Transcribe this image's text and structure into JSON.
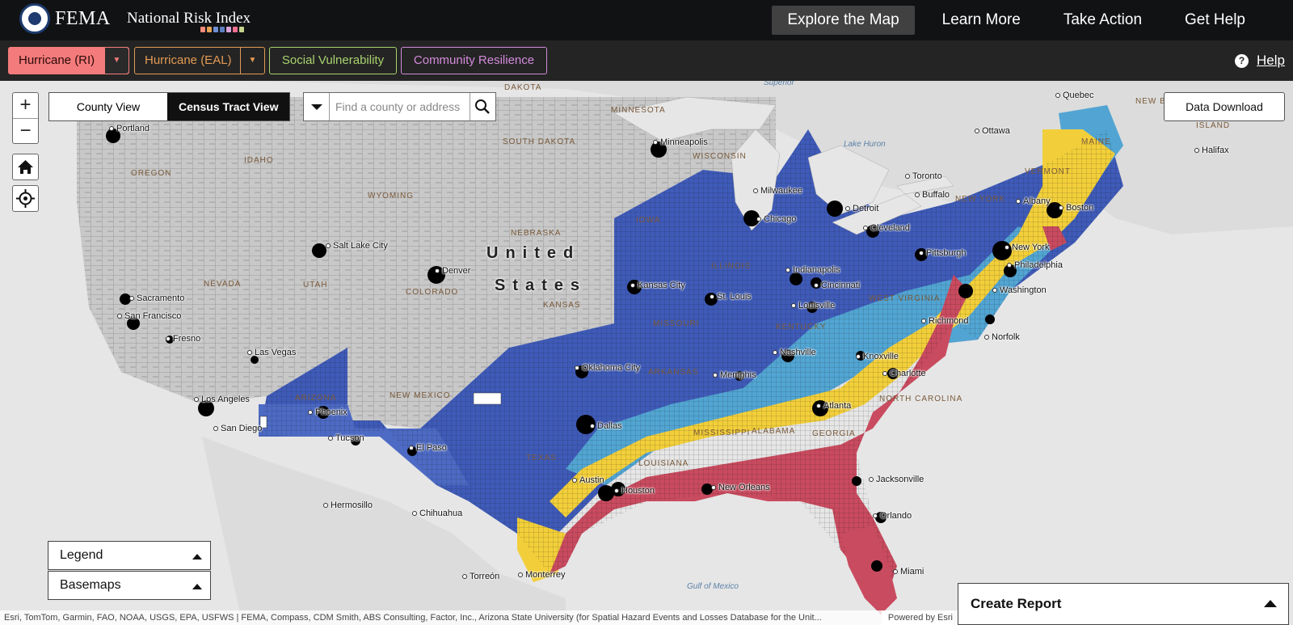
{
  "header": {
    "agency": "FEMA",
    "app_title": "National Risk Index",
    "brand_dots": [
      "#f58b7a",
      "#e2a255",
      "#6f8fd3",
      "#5d7fbf",
      "#d9a3d9",
      "#f06f8f",
      "#c6d38c"
    ],
    "nav": [
      {
        "label": "Explore the Map",
        "active": true
      },
      {
        "label": "Learn More",
        "active": false
      },
      {
        "label": "Take Action",
        "active": false
      },
      {
        "label": "Get Help",
        "active": false
      }
    ]
  },
  "hazard_bar": {
    "risk_index": {
      "label": "Hurricane (RI)",
      "color": "#f47b7b",
      "dropdown_icon": "caret-down-icon"
    },
    "eal": {
      "label": "Hurricane (EAL)",
      "color": "#e49b53",
      "dropdown_icon": "caret-down-icon"
    },
    "social_vulnerability": {
      "label": "Social Vulnerability",
      "color": "#a9d36f"
    },
    "community_resilience": {
      "label": "Community Resilience",
      "color": "#d38bdc"
    },
    "help": {
      "label": "Help",
      "icon": "question-circle-icon"
    }
  },
  "map_controls": {
    "zoom_in": "+",
    "zoom_out": "−",
    "home_icon": "home-icon",
    "locate_icon": "crosshair-icon",
    "view_toggle": {
      "county": "County View",
      "tract": "Census Tract View",
      "active": "tract"
    },
    "search": {
      "placeholder": "Find a county or address",
      "icon": "search-icon",
      "dropdown_icon": "caret-down-icon"
    },
    "data_download": "Data Download"
  },
  "map": {
    "risk_colors": {
      "very_high": "#c94b5f",
      "relatively_high": "#f2cf3a",
      "relatively_moderate": "#52a5d3",
      "relatively_low": "#4d6ac4",
      "very_low": "#3f5bb8",
      "not_applicable": "#cccccc",
      "water": "#e8e8e8"
    },
    "country_label": [
      "United",
      "States"
    ],
    "states": [
      "DAKOTA",
      "MINNESOTA",
      "SOUTH DAKOTA",
      "IDAHO",
      "OREGON",
      "WYOMING",
      "NEBRASKA",
      "IOWA",
      "NEVADA",
      "UTAH",
      "COLORADO",
      "KANSAS",
      "ILLINOIS",
      "MISSOURI",
      "ARIZONA",
      "NEW MEXICO",
      "ARKANSAS",
      "TEXAS",
      "MISSISSIPPI",
      "ALABAMA",
      "GEORGIA",
      "LOUISIANA",
      "KENTUCKY",
      "WEST VIRGINIA",
      "NORTH CAROLINA",
      "VERMONT",
      "MAINE",
      "NEW YORK",
      "WISCONSIN",
      "NEW BRUNSWICK",
      "ISLAND"
    ],
    "cities": [
      "Portland",
      "Minneapolis",
      "Quebec",
      "Ottawa",
      "Halifax",
      "Toronto",
      "Buffalo",
      "Albany",
      "Boston",
      "Milwaukee",
      "Detroit",
      "Chicago",
      "Cleveland",
      "Salt Lake City",
      "Pittsburgh",
      "New York",
      "Philadelphia",
      "Denver",
      "Indianapolis",
      "Cincinnati",
      "Washington",
      "Kansas City",
      "St. Louis",
      "Louisville",
      "Sacramento",
      "San Francisco",
      "Richmond",
      "Norfolk",
      "Fresno",
      "Las Vegas",
      "Nashville",
      "Knoxville",
      "Oklahoma City",
      "Charlotte",
      "Memphis",
      "Los Angeles",
      "Atlanta",
      "Phoenix",
      "San Diego",
      "Dallas",
      "Tucson",
      "El Paso",
      "Jacksonville",
      "Austin",
      "Houston",
      "New Orleans",
      "Orlando",
      "Hermosillo",
      "Chihuahua",
      "Miami",
      "Torreón",
      "Monterrey"
    ],
    "water": [
      "Superior",
      "Lake Huron",
      "Gulf of Mexico"
    ]
  },
  "panels": {
    "legend": "Legend",
    "basemaps": "Basemaps",
    "create_report": "Create Report"
  },
  "attribution": {
    "text": "Esri, TomTom, Garmin, FAO, NOAA, USGS, EPA, USFWS | FEMA, Compass, CDM Smith, ABS Consulting, Factor, Inc., Arizona State University (for Spatial Hazard Events and Losses Database for the Unit...",
    "powered_by": "Powered by Esri"
  }
}
